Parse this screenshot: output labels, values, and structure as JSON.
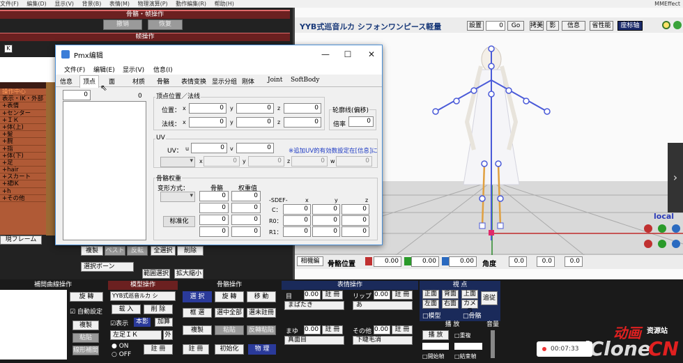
{
  "menubar": {
    "items": [
      "文件(F)",
      "編集(D)",
      "显示(V)",
      "背景(B)",
      "表情(M)",
      "物理演算(P)",
      "動作編集(R)",
      "帮助(H)"
    ],
    "right_label": "MMEffect"
  },
  "left_panel": {
    "bone_frame_header": "骨骼・帧操作",
    "undo_label": "撤销",
    "redo_label": "恢复",
    "frame_op_header": "帧操作",
    "k_label": "K",
    "bone_list": [
      "操作中心",
      "表示・IK・外部",
      "+表情",
      "+センター",
      "+ＩＫ",
      "+体(上)",
      "+髪",
      "+腕",
      "+指",
      "+体(下)",
      "+足",
      "+hair",
      "+スカート",
      "+裙IK",
      "+h",
      "+その他"
    ],
    "current_frame_label": "現フレーム",
    "copy_label": "複製",
    "paste_label": "ペスト",
    "reverse_paste_label": "反転",
    "select_all_label": "全選択",
    "delete_label": "削除",
    "select_combo": "選択ボーン",
    "range_select_label": "範囲選択",
    "expand_label": "拡大縮小"
  },
  "viewport": {
    "title": "YYB式巡音ルカ シフォンワンピース軽量",
    "settings_label": "設置",
    "frame_value": "0",
    "go_label": "Go",
    "view_labels": [
      "拷美",
      "影",
      "信息",
      "省性能",
      "座标轴"
    ],
    "local_label": "local",
    "bottom_label": "相機編",
    "bone_pos_label": "骨骼位置",
    "x_value": "0.00",
    "y_value": "0.00",
    "z_value": "0.00",
    "angle_label": "角度",
    "angle_x": "0.0",
    "angle_y": "0.0",
    "angle_z": "0.0"
  },
  "bottom_panel": {
    "curve_header": "補間曲線操作",
    "rotate_label": "旋 轉",
    "auto_setting_label": "自動設定",
    "copy_label": "複製",
    "paste_label": "粘貼",
    "linear_label": "線形補間",
    "model_op_header": "模型操作",
    "model_combo": "YYB式巡音ルカ シ",
    "load_label": "载 入",
    "delete_label": "削 除",
    "display_label": "表示",
    "mirror_label": "本影",
    "add_label": "加算",
    "ik_combo": "左足ＩＫ",
    "outside_label": "外",
    "on_label": "ON",
    "off_label": "OFF",
    "register_label": "註 冊",
    "bone_op_header": "骨骼操作",
    "select_label": "選 択",
    "rotate2_label": "旋 轉",
    "move_label": "移 動",
    "box_select_label": "框 選",
    "select_all_label": "選中全部",
    "unregistered_label": "選未註冊",
    "copy2_label": "複製",
    "paste2_label": "粘貼",
    "reverse_label": "反轉粘貼",
    "register2_label": "註 冊",
    "init_label": "初始化",
    "physics_label": "物 理",
    "expression_header": "表情操作",
    "eye_label": "目",
    "lip_label": "リップ",
    "mouth_label": "まゆ",
    "other_label": "その他",
    "val1": "0.00",
    "val2": "0.00",
    "val3": "0.00",
    "val4": "0.00",
    "combo_eye": "まばたき",
    "combo_lip": "あ",
    "combo_brow": "真面目",
    "combo_other": "下睫毛消",
    "view_header": "視 点",
    "front_label": "正面",
    "back_label": "背面",
    "top_label": "上面",
    "follow_label": "追従",
    "left_label": "左面",
    "right_label": "右面",
    "camera_label": "カメラ",
    "model_chk": "模型",
    "bone_chk": "骨骼",
    "play_header": "播 放",
    "play_label": "播 放",
    "repeat_label": "重複",
    "from_label": "開始幀",
    "to_label": "結束幀",
    "volume_label": "音量"
  },
  "dialog": {
    "title": "Pmx编辑",
    "menu": [
      "文件(F)",
      "编辑(E)",
      "显示(V)",
      "信息(I)"
    ],
    "tabs": [
      "信息",
      "顶点",
      "面",
      "材质",
      "骨骼",
      "表情变换",
      "显示分组",
      "刚体",
      "Joint",
      "SoftBody"
    ],
    "active_tab": "顶点",
    "vertex_index": "0",
    "vertex_count": "0",
    "pos_normal_group": "顶点位置／法线",
    "position_label": "位置：",
    "normal_label": "法线：",
    "x_label": "x",
    "y_label": "y",
    "z_label": "z",
    "pos_x": "0",
    "pos_y": "0",
    "pos_z": "0",
    "normal_x": "0",
    "normal_y": "0",
    "normal_z": "0",
    "edge_group": "轮廓线(偏移)",
    "ratio_label": "倍率",
    "ratio_value": "0",
    "uv_group": "UV",
    "uv_label": "UV：",
    "u_label": "u",
    "v_label": "v",
    "uv_u": "0",
    "uv_v": "0",
    "uv_note": "※追加UV的有効数設定在[信息]に",
    "add_uv_x_label": "x",
    "add_uv_y_label": "y",
    "add_uv_z_label": "z",
    "add_uv_w_label": "w",
    "add_uv_x": "0",
    "add_uv_y": "0",
    "add_uv_z": "0",
    "add_uv_w": "0",
    "weight_group": "骨骼权重",
    "deform_label": "变形方式：",
    "bone_label": "骨骼",
    "weight_label": "权重值",
    "bones": [
      "0",
      "0",
      "0",
      "0"
    ],
    "weights": [
      "0",
      "0",
      "0",
      "0"
    ],
    "normalize_label": "标准化",
    "sdef_label": "-SDEF-",
    "sdef_x": "x",
    "sdef_y": "y",
    "sdef_z": "z",
    "c_label": "C：",
    "r0_label": "R0：",
    "r1_label": "R1：",
    "c_vals": [
      "0",
      "0",
      "0"
    ],
    "r0_vals": [
      "0",
      "0",
      "0"
    ],
    "r1_vals": [
      "0",
      "0",
      "0"
    ]
  },
  "overlay": {
    "timer": "00:07:33",
    "watermark_cn": "动画",
    "watermark_site": "资源站",
    "watermark_en": "iClone",
    "watermark_cn2": "CN"
  }
}
